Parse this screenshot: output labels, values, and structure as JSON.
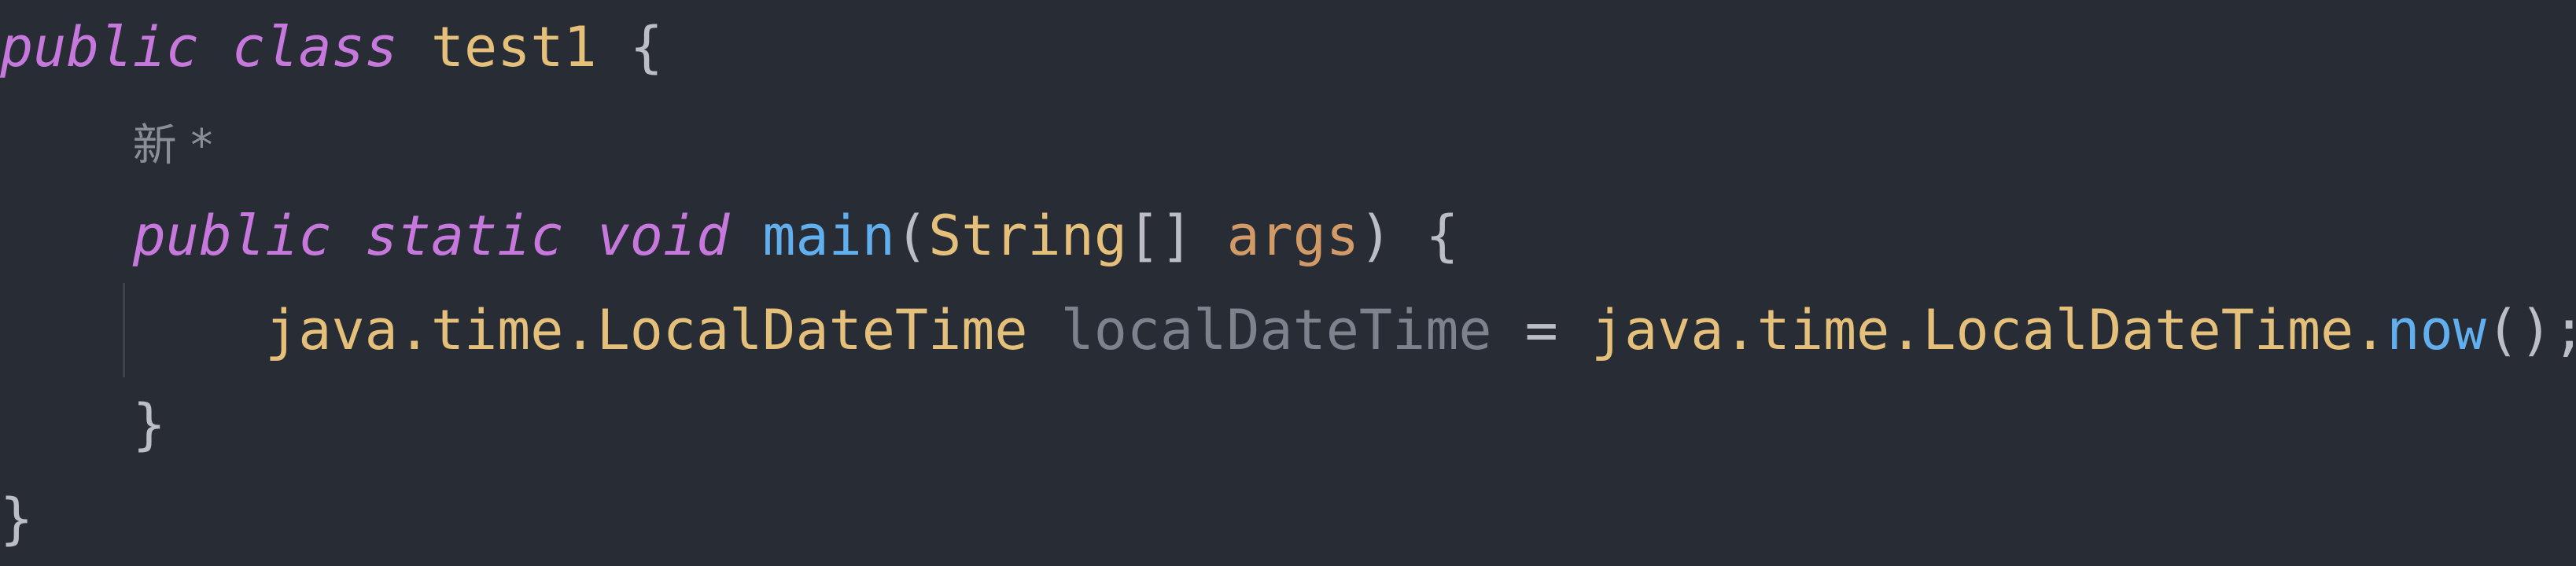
{
  "colors": {
    "background": "#282c34",
    "keyword": "#c678dd",
    "class_name": "#e5c07b",
    "function_name": "#61afef",
    "parameter": "#d19a66",
    "unused_variable": "#7d828c",
    "punctuation": "#bbbec4"
  },
  "code": {
    "line1": {
      "kw_public": "public",
      "kw_class": "class",
      "class_name": "test1",
      "brace_open": "{"
    },
    "line2": {
      "inlay_hint": "新 *"
    },
    "line3": {
      "kw_public": "public",
      "kw_static": "static",
      "kw_void": "void",
      "method_name": "main",
      "paren_open": "(",
      "param_type": "String",
      "brackets": "[]",
      "param_name": "args",
      "paren_close": ")",
      "brace_open": "{"
    },
    "line4": {
      "type": "java.time.LocalDateTime",
      "var_name": "localDateTime",
      "assign": "=",
      "call_target": "java.time.LocalDateTime.",
      "call_method": "now",
      "call_end": "();"
    },
    "line5": {
      "brace_close": "}"
    },
    "line6": {
      "brace_close": "}"
    }
  }
}
